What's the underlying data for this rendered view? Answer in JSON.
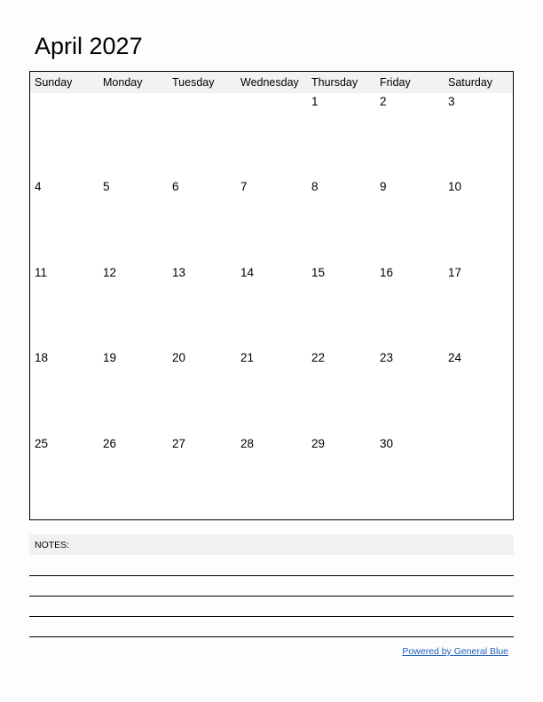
{
  "title": "April 2027",
  "weekdays": [
    "Sunday",
    "Monday",
    "Tuesday",
    "Wednesday",
    "Thursday",
    "Friday",
    "Saturday"
  ],
  "weeks": [
    [
      "",
      "",
      "",
      "",
      "1",
      "2",
      "3"
    ],
    [
      "4",
      "5",
      "6",
      "7",
      "8",
      "9",
      "10"
    ],
    [
      "11",
      "12",
      "13",
      "14",
      "15",
      "16",
      "17"
    ],
    [
      "18",
      "19",
      "20",
      "21",
      "22",
      "23",
      "24"
    ],
    [
      "25",
      "26",
      "27",
      "28",
      "29",
      "30",
      ""
    ]
  ],
  "notes": {
    "label": "NOTES:",
    "line_count": 4
  },
  "footer": {
    "link_text": "Powered by General Blue",
    "link_color": "#1f5fbf"
  },
  "colors": {
    "header_bg": "#f2f2f2",
    "notes_bg": "#f1f1f1",
    "border": "#000000"
  }
}
